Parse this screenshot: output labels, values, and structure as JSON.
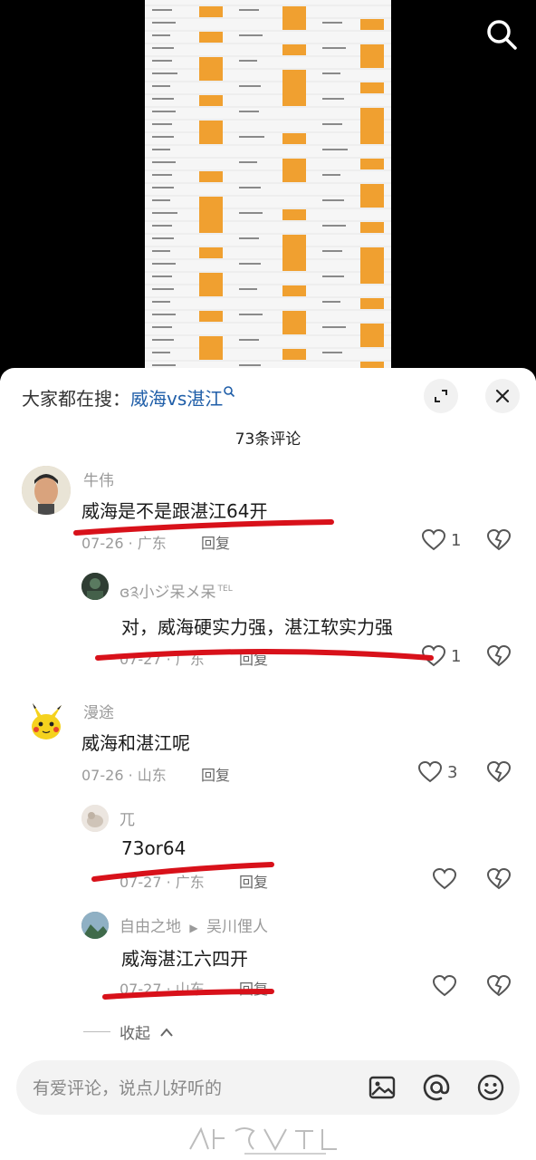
{
  "search_banner": {
    "prefix": "大家都在搜：",
    "query": "威海vs湛江"
  },
  "comment_count": "73条评论",
  "comments": [
    {
      "user": "牛伟",
      "text": "威海是不是跟湛江64开",
      "date": "07-26 · 广东",
      "reply": "回复",
      "likes": "1"
    },
    {
      "user": "ɞ༉小ジ呆メ呆",
      "user_tag": "TEL",
      "text": "对，威海硬实力强，湛江软实力强",
      "date": "07-27 · 广东",
      "reply": "回复",
      "likes": "1"
    },
    {
      "user": "漫途",
      "text": "威海和湛江呢",
      "date": "07-26 · 山东",
      "reply": "回复",
      "likes": "3"
    },
    {
      "user": "兀",
      "text": "73or64",
      "date": "07-27 · 广东",
      "reply": "回复",
      "likes": ""
    },
    {
      "user": "自由之地",
      "reply_to": "吴川俚人",
      "text": "威海湛江六四开",
      "date": "07-27 · 山东",
      "reply": "回复",
      "likes": ""
    }
  ],
  "collapse_label": "收起",
  "input": {
    "placeholder": "有爱评论，说点儿好听的"
  },
  "colors": {
    "link": "#1f5ea8",
    "annotation_red": "#d8111a",
    "sheet_orange": "#f0a030"
  },
  "icons": [
    "search-icon",
    "expand-icon",
    "close-icon",
    "heart-icon",
    "broken-heart-icon",
    "image-icon",
    "at-icon",
    "emoji-icon",
    "chevron-up-icon"
  ]
}
